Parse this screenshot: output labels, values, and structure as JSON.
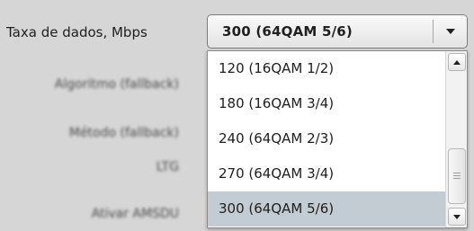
{
  "form": {
    "data_rate_label": "Taxa de dados, Mbps",
    "blurred_labels": [
      "Algoritmo (fallback)",
      "Método (fallback)",
      "LTG",
      "Ativar AMSDU"
    ]
  },
  "combo": {
    "selected_value": "300 (64QAM 5/6)",
    "arrow_icon": "triangle-down-icon"
  },
  "dropdown": {
    "options": [
      {
        "label": "120 (16QAM 1/2)",
        "selected": false
      },
      {
        "label": "180 (16QAM 3/4)",
        "selected": false
      },
      {
        "label": "240 (64QAM 2/3)",
        "selected": false
      },
      {
        "label": "270 (64QAM 3/4)",
        "selected": false
      },
      {
        "label": "300 (64QAM 5/6)",
        "selected": true
      }
    ],
    "highlight_color": "#c3ccd2",
    "scroll_up_icon": "triangle-up-icon",
    "scroll_down_icon": "triangle-down-icon",
    "thumb_grip_icon": "grip-lines-icon"
  }
}
